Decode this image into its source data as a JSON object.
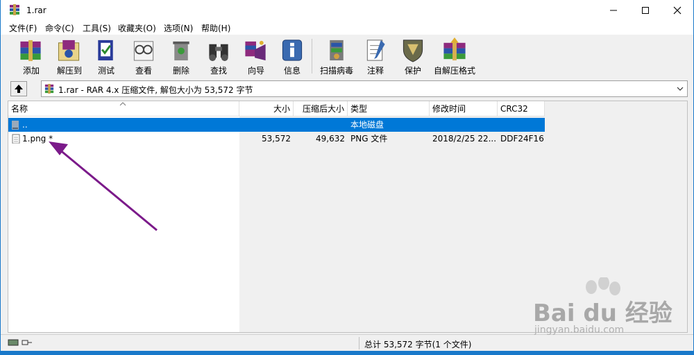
{
  "window": {
    "title": "1.rar"
  },
  "menu": [
    "文件(F)",
    "命令(C)",
    "工具(S)",
    "收藏夹(O)",
    "选项(N)",
    "帮助(H)"
  ],
  "toolbar": [
    {
      "label": "添加",
      "icon": "add-archive-icon"
    },
    {
      "label": "解压到",
      "icon": "extract-to-icon"
    },
    {
      "label": "测试",
      "icon": "test-icon"
    },
    {
      "label": "查看",
      "icon": "view-icon"
    },
    {
      "label": "删除",
      "icon": "delete-icon"
    },
    {
      "label": "查找",
      "icon": "find-icon"
    },
    {
      "label": "向导",
      "icon": "wizard-icon"
    },
    {
      "label": "信息",
      "icon": "info-icon"
    },
    {
      "label": "扫描病毒",
      "icon": "virus-scan-icon"
    },
    {
      "label": "注释",
      "icon": "comment-icon"
    },
    {
      "label": "保护",
      "icon": "protect-icon"
    },
    {
      "label": "自解压格式",
      "icon": "sfx-icon"
    }
  ],
  "address": {
    "text": "1.rar - RAR 4.x 压缩文件, 解包大小为 53,572 字节"
  },
  "columns": [
    "名称",
    "大小",
    "压缩后大小",
    "类型",
    "修改时间",
    "CRC32"
  ],
  "rows": [
    {
      "name": "..",
      "size": "",
      "packed": "",
      "type": "本地磁盘",
      "modified": "",
      "crc": "",
      "selected": true
    },
    {
      "name": "1.png *",
      "size": "53,572",
      "packed": "49,632",
      "type": "PNG 文件",
      "modified": "2018/2/25 22...",
      "crc": "DDF24F16",
      "selected": false
    }
  ],
  "status": {
    "text": "总计 53,572 字节(1 个文件)"
  },
  "watermark": {
    "brand": "Bai du 经验",
    "url": "jingyan.baidu.com"
  },
  "colors": {
    "accent": "#0078d7",
    "arrow": "#7b1a8a",
    "border": "#1979ca"
  }
}
